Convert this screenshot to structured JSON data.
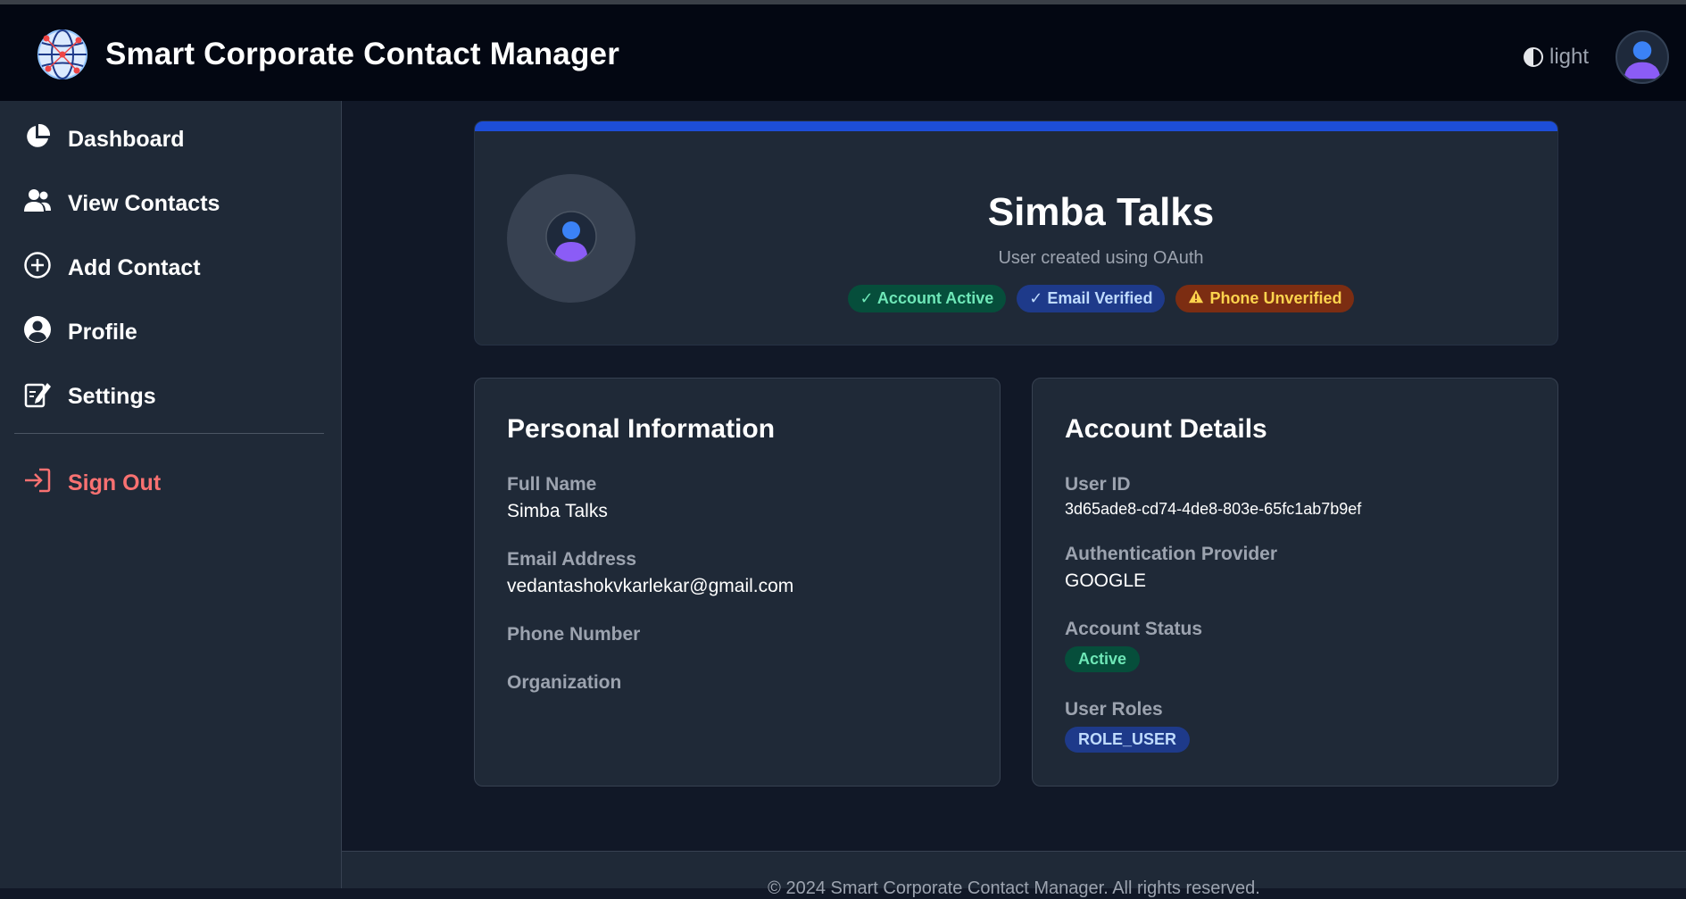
{
  "header": {
    "app_title": "Smart Corporate Contact Manager",
    "logo_icon": "globe-network-icon",
    "theme_label": "light",
    "theme_icon": "half-circle-icon",
    "avatar_icon": "user-avatar-icon"
  },
  "sidebar": {
    "items": [
      {
        "label": "Dashboard",
        "icon": "pie-chart-icon"
      },
      {
        "label": "View Contacts",
        "icon": "users-icon"
      },
      {
        "label": "Add Contact",
        "icon": "plus-circle-icon"
      },
      {
        "label": "Profile",
        "icon": "user-circle-icon"
      },
      {
        "label": "Settings",
        "icon": "edit-note-icon"
      }
    ],
    "sign_out": {
      "label": "Sign Out",
      "icon": "sign-out-icon",
      "color": "#f87171"
    }
  },
  "profile": {
    "name": "Simba Talks",
    "subtitle": "User created using OAuth",
    "badges": [
      {
        "label": "✓ Account Active",
        "style": "green"
      },
      {
        "label": "✓ Email Verified",
        "style": "blue"
      },
      {
        "label": "Phone Unverified",
        "style": "amber",
        "icon": "warning-icon"
      }
    ],
    "accent_color": "#1d4ed8"
  },
  "personal_info": {
    "title": "Personal Information",
    "full_name_label": "Full Name",
    "full_name": "Simba Talks",
    "email_label": "Email Address",
    "email": "vedantashokvkarlekar@gmail.com",
    "phone_label": "Phone Number",
    "organization_label": "Organization"
  },
  "account_details": {
    "title": "Account Details",
    "user_id_label": "User ID",
    "user_id": "3d65ade8-cd74-4de8-803e-65fc1ab7b9ef",
    "provider_label": "Authentication Provider",
    "provider": "GOOGLE",
    "status_label": "Account Status",
    "status": "Active",
    "roles_label": "User Roles",
    "role": "ROLE_USER"
  },
  "footer": {
    "text": "© 2024 Smart Corporate Contact Manager. All rights reserved."
  }
}
